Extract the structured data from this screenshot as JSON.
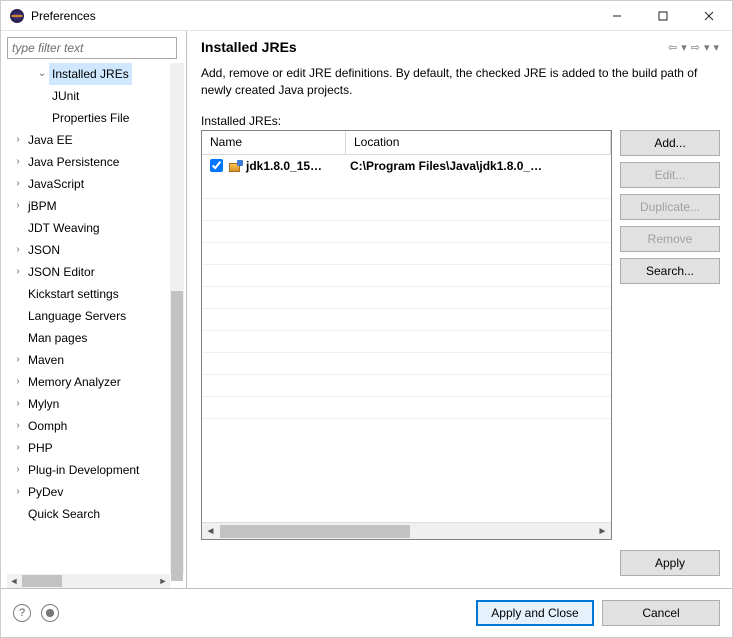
{
  "window": {
    "title": "Preferences"
  },
  "filter": {
    "placeholder": "type filter text"
  },
  "tree": {
    "items": [
      {
        "label": "Installed JREs",
        "indent": true,
        "expandable": true,
        "expanded": true,
        "selected": true
      },
      {
        "label": "JUnit",
        "indent": true,
        "expandable": false
      },
      {
        "label": "Properties File",
        "indent": true,
        "expandable": false
      },
      {
        "label": "Java EE",
        "expandable": true
      },
      {
        "label": "Java Persistence",
        "expandable": true
      },
      {
        "label": "JavaScript",
        "expandable": true
      },
      {
        "label": "jBPM",
        "expandable": true
      },
      {
        "label": "JDT Weaving",
        "expandable": false
      },
      {
        "label": "JSON",
        "expandable": true
      },
      {
        "label": "JSON Editor",
        "expandable": true
      },
      {
        "label": "Kickstart settings",
        "expandable": false
      },
      {
        "label": "Language Servers",
        "expandable": false
      },
      {
        "label": "Man pages",
        "expandable": false
      },
      {
        "label": "Maven",
        "expandable": true
      },
      {
        "label": "Memory Analyzer",
        "expandable": true
      },
      {
        "label": "Mylyn",
        "expandable": true
      },
      {
        "label": "Oomph",
        "expandable": true
      },
      {
        "label": "PHP",
        "expandable": true
      },
      {
        "label": "Plug-in Development",
        "expandable": true
      },
      {
        "label": "PyDev",
        "expandable": true
      },
      {
        "label": "Quick Search",
        "expandable": false
      }
    ]
  },
  "page": {
    "title": "Installed JREs",
    "description": "Add, remove or edit JRE definitions. By default, the checked JRE is added to the build path of newly created Java projects.",
    "table_label": "Installed JREs:"
  },
  "table": {
    "columns": {
      "name": "Name",
      "location": "Location"
    },
    "rows": [
      {
        "checked": true,
        "name": "jdk1.8.0_15…",
        "location": "C:\\Program Files\\Java\\jdk1.8.0_…"
      }
    ]
  },
  "buttons": {
    "add": "Add...",
    "edit": "Edit...",
    "duplicate": "Duplicate...",
    "remove": "Remove",
    "search": "Search...",
    "apply": "Apply",
    "apply_close": "Apply and Close",
    "cancel": "Cancel"
  }
}
